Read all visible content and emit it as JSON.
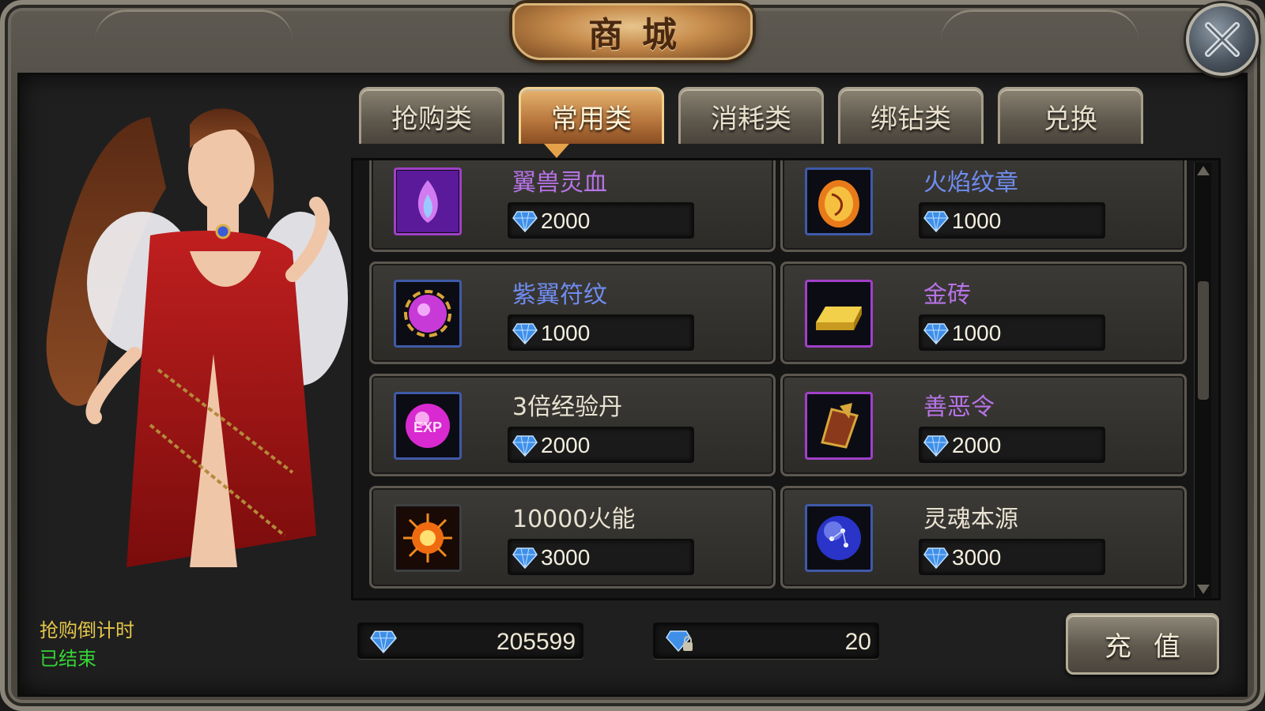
{
  "window": {
    "title": "商城",
    "close_icon": "close-x-icon"
  },
  "tabs": [
    {
      "label": "抢购类",
      "active": false
    },
    {
      "label": "常用类",
      "active": true
    },
    {
      "label": "消耗类",
      "active": false
    },
    {
      "label": "绑钻类",
      "active": false
    },
    {
      "label": "兑换",
      "active": false
    }
  ],
  "items": [
    {
      "name": "翼兽灵血",
      "price": "2000",
      "name_color": "#b673e6",
      "icon": "purple-flame-icon",
      "frame": "purple"
    },
    {
      "name": "火焰纹章",
      "price": "1000",
      "name_color": "#6f8cf0",
      "icon": "fire-emblem-icon",
      "frame": "blue"
    },
    {
      "name": "紫翼符纹",
      "price": "1000",
      "name_color": "#6f8cf0",
      "icon": "purple-orb-rune-icon",
      "frame": "blue"
    },
    {
      "name": "金砖",
      "price": "1000",
      "name_color": "#b673e6",
      "icon": "gold-bar-icon",
      "frame": "purple"
    },
    {
      "name": "3倍经验丹",
      "price": "2000",
      "name_color": "#e8e2d2",
      "icon": "exp-pill-icon",
      "frame": "blue"
    },
    {
      "name": "善恶令",
      "price": "2000",
      "name_color": "#b673e6",
      "icon": "order-token-icon",
      "frame": "purple"
    },
    {
      "name": "10000火能",
      "price": "3000",
      "name_color": "#e8e2d2",
      "icon": "fire-energy-icon",
      "frame": "dark"
    },
    {
      "name": "灵魂本源",
      "price": "3000",
      "name_color": "#e8e2d2",
      "icon": "soul-sphere-icon",
      "frame": "blue"
    }
  ],
  "flash_sale": {
    "label": "抢购倒计时",
    "status": "已结束"
  },
  "currency": {
    "diamonds": "205599",
    "bound_diamonds": "20"
  },
  "recharge_label": "充值",
  "colors": {
    "accent_gold": "#e6a24a",
    "diamond_blue": "#3f8fe8",
    "countdown_label": "#e4c64a",
    "countdown_status": "#35d635"
  }
}
